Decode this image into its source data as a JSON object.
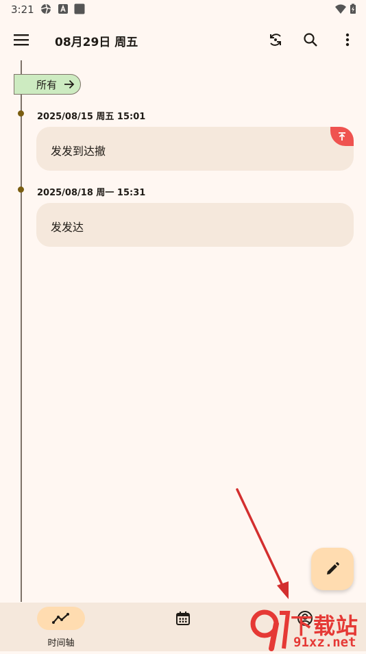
{
  "status_bar": {
    "time": "3:21"
  },
  "app_bar": {
    "title": "08月29日 周五"
  },
  "filter": {
    "label": "所有"
  },
  "entries": [
    {
      "date": "2025/08/15 周五 15:01",
      "text": "发发到达撤",
      "pinned": true
    },
    {
      "date": "2025/08/18 周一 15:31",
      "text": "发发达",
      "pinned": false
    }
  ],
  "bottom_nav": {
    "items": [
      {
        "label": "时间轴",
        "icon": "timeline-icon",
        "active": true
      },
      {
        "label": "",
        "icon": "calendar-icon",
        "active": false
      },
      {
        "label": "",
        "icon": "profile-icon",
        "active": false
      }
    ]
  },
  "watermark": {
    "top": "下载站",
    "bottom": "91xz.net",
    "logo": "9"
  },
  "colors": {
    "background": "#fff7f2",
    "card": "#f5e8dc",
    "accent": "#ffdcb0",
    "filter_tag": "#cdebc1",
    "pin": "#ef5350",
    "dot": "#7a5d10",
    "annotation": "#d32f2f"
  }
}
